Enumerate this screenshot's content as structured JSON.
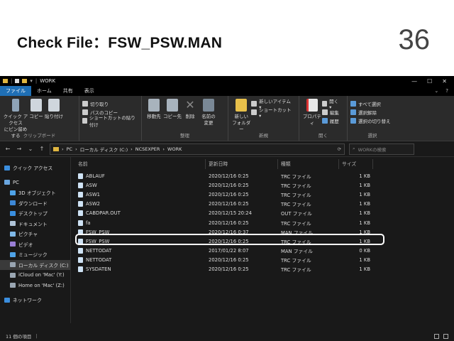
{
  "slide": {
    "title": "Check File：FSW_PSW.MAN",
    "page_number": "36"
  },
  "window": {
    "title": "WORK",
    "tabs": [
      "ファイル",
      "ホーム",
      "共有",
      "表示"
    ],
    "active_tab": "ファイル",
    "ribbon": {
      "clipboard": {
        "label": "クリップボード",
        "pin": "クイック アクセス\nにピン留めする",
        "copy": "コピー",
        "paste": "貼り付け",
        "cut": "切り取り",
        "copy_path": "パスのコピー",
        "paste_shortcut": "ショートカットの貼り付け"
      },
      "organize": {
        "label": "整理",
        "move_to": "移動先",
        "copy_to": "コピー先",
        "delete": "削除",
        "rename": "名前の\n変更"
      },
      "new": {
        "label": "新規",
        "new_folder": "新しい\nフォルダー",
        "new_item": "新しいアイテム ▾",
        "shortcut": "ショートカット ▾"
      },
      "open": {
        "label": "開く",
        "properties": "プロパティ",
        "open": "開く ▾",
        "edit": "編集",
        "history": "履歴"
      },
      "select": {
        "label": "選択",
        "select_all": "すべて選択",
        "select_none": "選択解除",
        "invert": "選択の切り替え"
      }
    },
    "address": {
      "path": [
        "PC",
        "ローカル ディスク (C:)",
        "NCSEXPER",
        "WORK"
      ],
      "search_placeholder": "WORKの検索"
    },
    "nav": [
      {
        "label": "クイック アクセス",
        "color": "#3b8ede"
      },
      {
        "label": "PC",
        "color": "#6aa6e0"
      },
      {
        "label": "3D オブジェクト",
        "color": "#4fa3e8"
      },
      {
        "label": "ダウンロード",
        "color": "#3d88d6"
      },
      {
        "label": "デスクトップ",
        "color": "#3a8fe0"
      },
      {
        "label": "ドキュメント",
        "color": "#b0c4d8"
      },
      {
        "label": "ピクチャ",
        "color": "#7fb8e8"
      },
      {
        "label": "ビデオ",
        "color": "#9a7fd6"
      },
      {
        "label": "ミュージック",
        "color": "#4fa3e8"
      },
      {
        "label": "ローカル ディスク (C:)",
        "color": "#9aa6b2"
      },
      {
        "label": "iCloud on 'Mac' (Y:)",
        "color": "#9aa6b2"
      },
      {
        "label": "Home on 'Mac' (Z:)",
        "color": "#9aa6b2"
      },
      {
        "label": "ネットワーク",
        "color": "#3b8ede"
      }
    ],
    "columns": {
      "name": "名前",
      "date": "更新日時",
      "type": "種類",
      "size": "サイズ"
    },
    "files": [
      {
        "name": "ABLAUF",
        "date": "2020/12/16 0:25",
        "type": "TRC ファイル",
        "size": "1 KB"
      },
      {
        "name": "ASW",
        "date": "2020/12/16 0:25",
        "type": "TRC ファイル",
        "size": "1 KB"
      },
      {
        "name": "ASW1",
        "date": "2020/12/16 0:25",
        "type": "TRC ファイル",
        "size": "1 KB"
      },
      {
        "name": "ASW2",
        "date": "2020/12/16 0:25",
        "type": "TRC ファイル",
        "size": "1 KB"
      },
      {
        "name": "CABDPAR.OUT",
        "date": "2020/12/15 20:24",
        "type": "OUT ファイル",
        "size": "1 KB"
      },
      {
        "name": "fa",
        "date": "2020/12/16 0:25",
        "type": "TRC ファイル",
        "size": "1 KB"
      },
      {
        "name": "FSW_PSW",
        "date": "2020/12/16 0:37",
        "type": "MAN ファイル",
        "size": "1 KB"
      },
      {
        "name": "FSW_PSW",
        "date": "2020/12/16 0:25",
        "type": "TRC ファイル",
        "size": "1 KB"
      },
      {
        "name": "NETTODAT",
        "date": "2017/01/22 8:07",
        "type": "MAN ファイル",
        "size": "0 KB"
      },
      {
        "name": "NETTODAT",
        "date": "2020/12/16 0:25",
        "type": "TRC ファイル",
        "size": "1 KB"
      },
      {
        "name": "SYSDATEN",
        "date": "2020/12/16 0:25",
        "type": "TRC ファイル",
        "size": "1 KB"
      }
    ],
    "status": "11 個の項目"
  }
}
